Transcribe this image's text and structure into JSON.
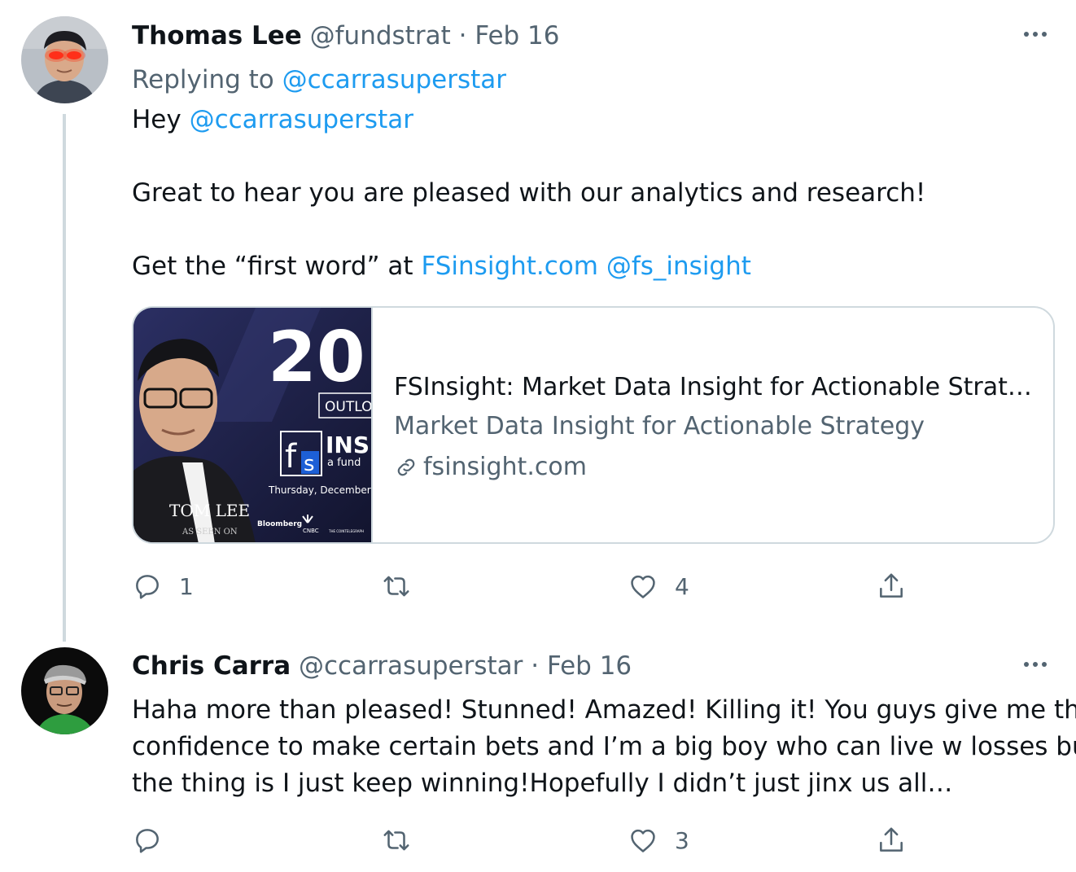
{
  "tweets": [
    {
      "author_name": "Thomas Lee",
      "handle": "@fundstrat",
      "separator": "·",
      "date": "Feb 16",
      "replying_label": "Replying to",
      "replying_handle": "@ccarrasuperstar",
      "lines": {
        "l1_text": "Hey",
        "l1_mention": "@ccarrasuperstar",
        "l2_text": "Great to hear you are pleased with our analytics and research!",
        "l3_text": "Get the “first word” at",
        "l3_link": "FSinsight.com",
        "l3_mention": "@fs_insight"
      },
      "card": {
        "title": "FSInsight: Market Data Insight for Actionable Strate...",
        "description": "Market Data Insight for Actionable Strategy",
        "domain": "fsinsight.com",
        "image_text": {
          "big_number": "20",
          "outlook": "OUTLO",
          "brand": "INS",
          "brand_sub": "a fund",
          "date_line": "Thursday, December",
          "person": "TOM LEE",
          "seen_on": "AS SEEN ON",
          "media1": "Bloomberg",
          "media2": "CNBC",
          "media3": "THE COINTELEGRAPH"
        }
      },
      "actions": {
        "reply_count": "1",
        "retweet_count": "",
        "like_count": "4"
      }
    },
    {
      "author_name": "Chris Carra",
      "handle": "@ccarrasuperstar",
      "separator": "·",
      "date": "Feb 16",
      "body_lines": [
        "Haha more than pleased! Stunned! Amazed! Killing it! You guys give me the",
        "confidence to make certain bets and I’m a big boy who can live w losses but",
        "the thing is I just keep winning!Hopefully I didn’t just jinx us all…"
      ],
      "actions": {
        "reply_count": "",
        "retweet_count": "",
        "like_count": "3"
      }
    }
  ],
  "colors": {
    "text": "#0f1419",
    "secondary": "#536471",
    "link": "#1d9bf0",
    "border": "#cfd9de"
  },
  "icons": [
    "reply-icon",
    "retweet-icon",
    "like-icon",
    "share-icon",
    "more-icon",
    "link-icon"
  ]
}
